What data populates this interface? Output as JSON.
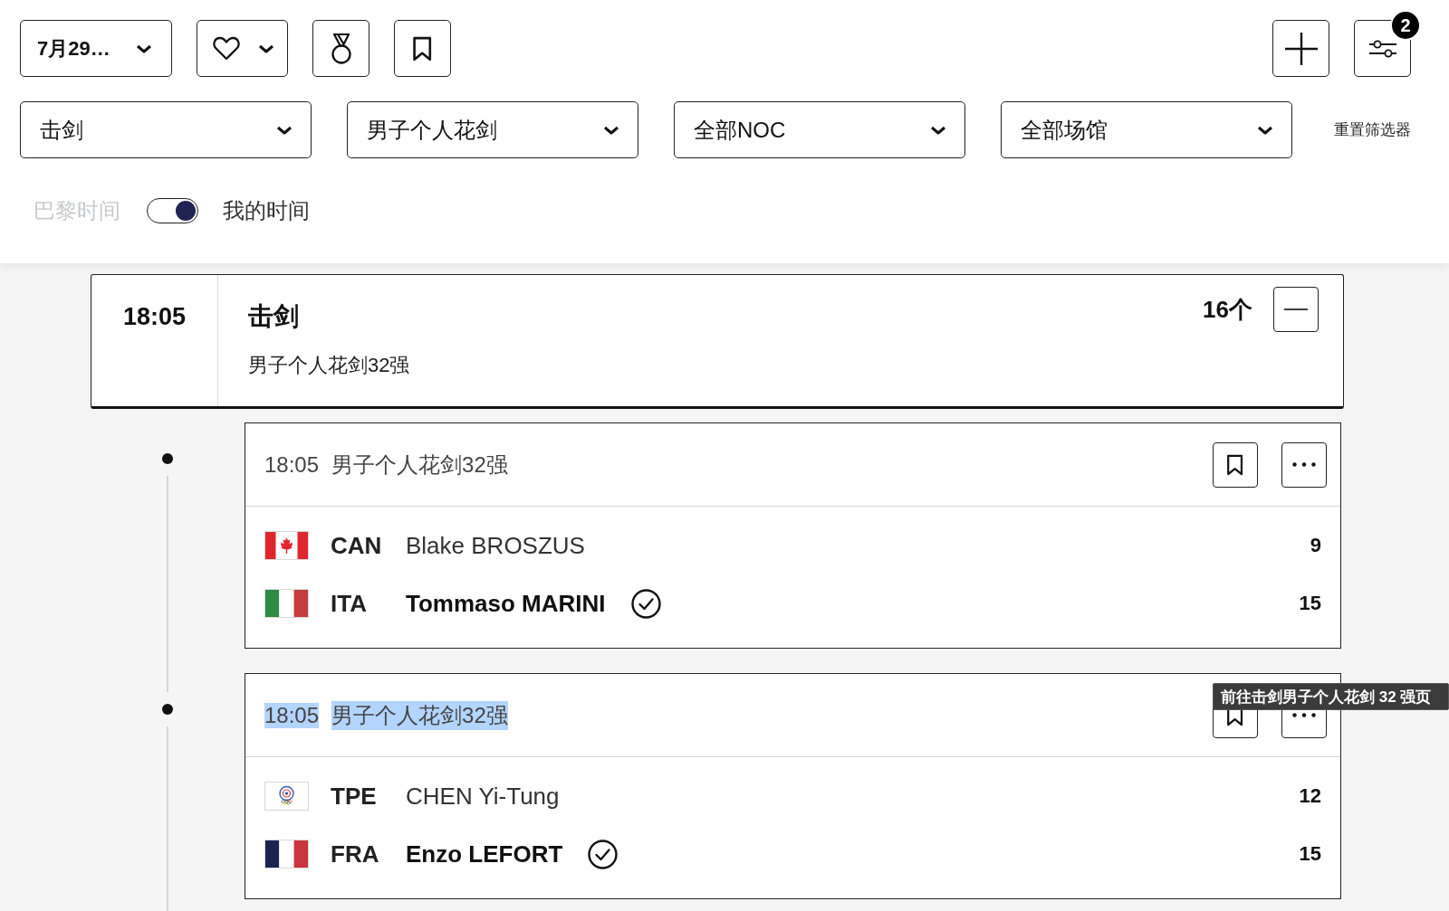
{
  "toolbar": {
    "date_button": {
      "label": "7月29…"
    },
    "filter_badge": "2"
  },
  "filters": [
    {
      "label": "击剑"
    },
    {
      "label": "男子个人花剑"
    },
    {
      "label": "全部NOC"
    },
    {
      "label": "全部场馆"
    }
  ],
  "reset_filters": "重置筛选器",
  "time_toggle": {
    "left_label": "巴黎时间",
    "right_label": "我的时间",
    "on": true
  },
  "event": {
    "time": "18:05",
    "sport": "击剑",
    "name": "男子个人花剑32强",
    "count": "16个",
    "expanded": true
  },
  "matches": [
    {
      "time": "18:05",
      "title": "男子个人花剑32强",
      "highlighted": false,
      "competitors": [
        {
          "kind": "canada",
          "noc": "CAN",
          "name": "Blake BROSZUS",
          "score": "9",
          "winner": false
        },
        {
          "kind": "italy",
          "noc": "ITA",
          "name": "Tommaso MARINI",
          "score": "15",
          "winner": true
        }
      ]
    },
    {
      "time": "18:05",
      "title": "男子个人花剑32强",
      "highlighted": true,
      "tooltip": "前往击剑男子个人花剑 32 强页",
      "competitors": [
        {
          "kind": "taipei",
          "noc": "TPE",
          "name": "CHEN Yi-Tung",
          "score": "12",
          "winner": false
        },
        {
          "kind": "france",
          "noc": "FRA",
          "name": "Enzo LEFORT",
          "score": "15",
          "winner": true
        }
      ]
    }
  ]
}
